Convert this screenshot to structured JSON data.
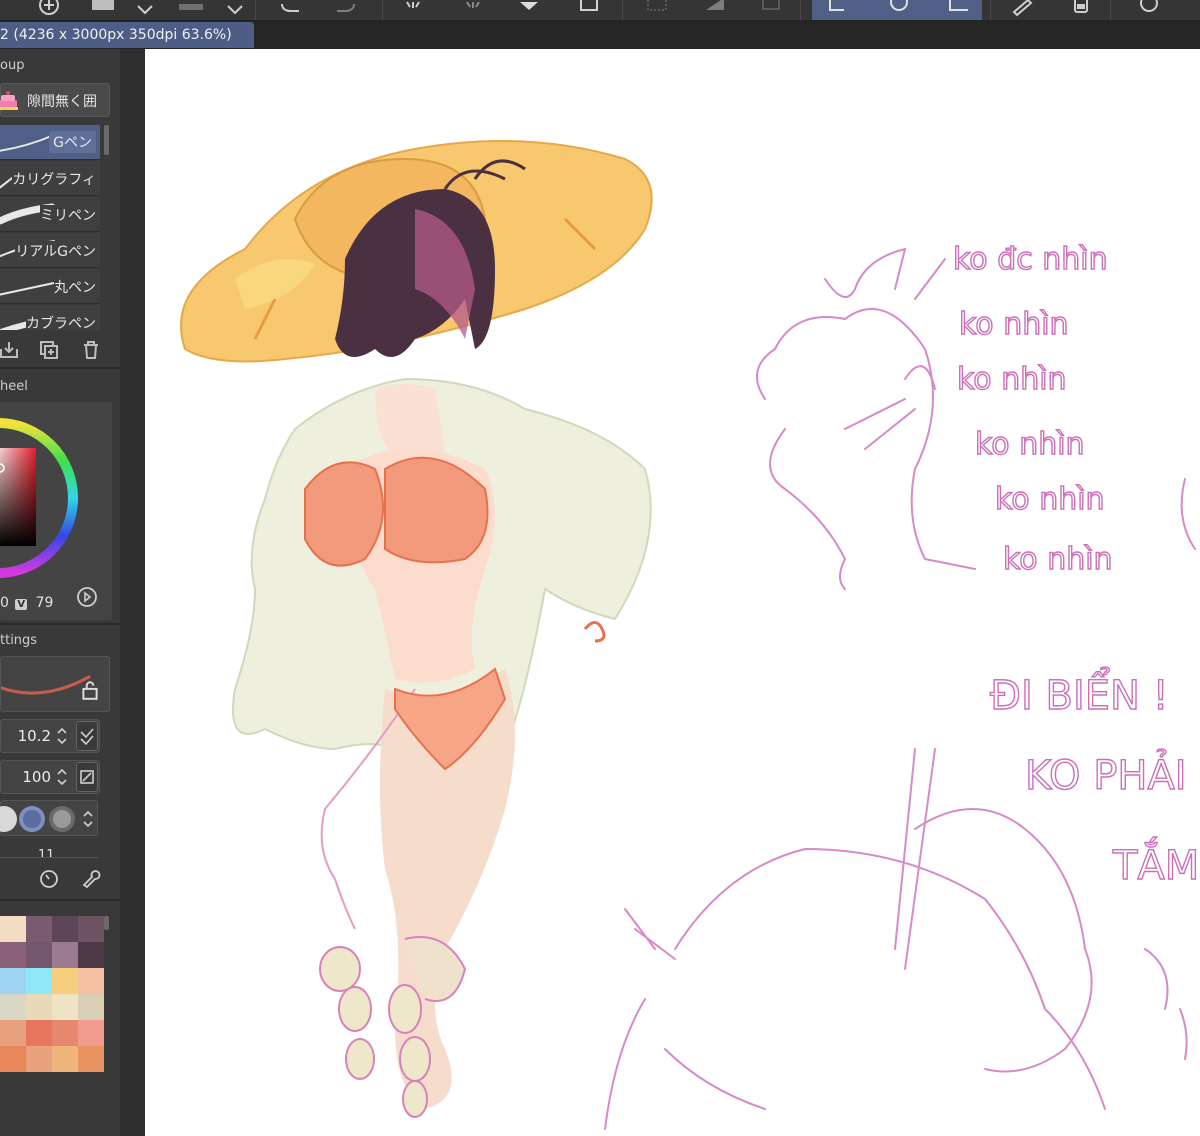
{
  "document": {
    "tab_title": "2 (4236 x 3000px 350dpi 63.6%)"
  },
  "toolbar": {
    "icons": [
      "new-canvas-icon",
      "save-icon",
      "undo-icon",
      "redo-icon",
      "clear-icon",
      "fill-icon",
      "transform-icon",
      "deselect-icon",
      "lasso-select-icon",
      "ellipse-select-icon",
      "rect-select-icon",
      "pen-icon",
      "device-icon",
      "help-icon"
    ]
  },
  "sub_tool_group": {
    "title": "oup",
    "set_label": "隙間無く囲"
  },
  "brushes": [
    {
      "name": "Gペン",
      "selected": true
    },
    {
      "name": "カリグラフィ",
      "selected": false
    },
    {
      "name": "ミリペン",
      "selected": false
    },
    {
      "name": "リアルGペン",
      "selected": false
    },
    {
      "name": "丸ペン",
      "selected": false
    },
    {
      "name": "カブラペン",
      "selected": false
    }
  ],
  "color_wheel": {
    "title": "heel",
    "v_label": "V",
    "s_value": "0",
    "v_value": "79",
    "current_color": "#d8a9a3"
  },
  "tool_settings": {
    "title": "ttings",
    "brush_size": "10.2",
    "opacity": "100",
    "stabilization": "11"
  },
  "palette": {
    "colors": [
      [
        "#f2dcc4",
        "#7a5a6e",
        "#5c4656",
        "#6e5462"
      ],
      [
        "#8a5f78",
        "#74576e",
        "#9b7a8f",
        "#4d3a47"
      ],
      [
        "#9fd3f2",
        "#8fe8f6",
        "#f5cf7e",
        "#f6c0a3"
      ],
      [
        "#d9d6c6",
        "#e8d9b8",
        "#efe3c4",
        "#d8cfb5"
      ],
      [
        "#e9a07f",
        "#e7775c",
        "#e68770",
        "#f29c8f"
      ],
      [
        "#e7875a",
        "#e9a37c",
        "#f0b57d",
        "#e99460"
      ]
    ]
  },
  "sketch_notes": {
    "lines": [
      "ko đc nhìn",
      "ko nhìn",
      "ko nhìn",
      "ko nhìn",
      "ko nhìn",
      "ko nhìn"
    ],
    "shout": [
      "ĐI BIỂN !",
      "KO PHẢI",
      "TẮM"
    ]
  }
}
